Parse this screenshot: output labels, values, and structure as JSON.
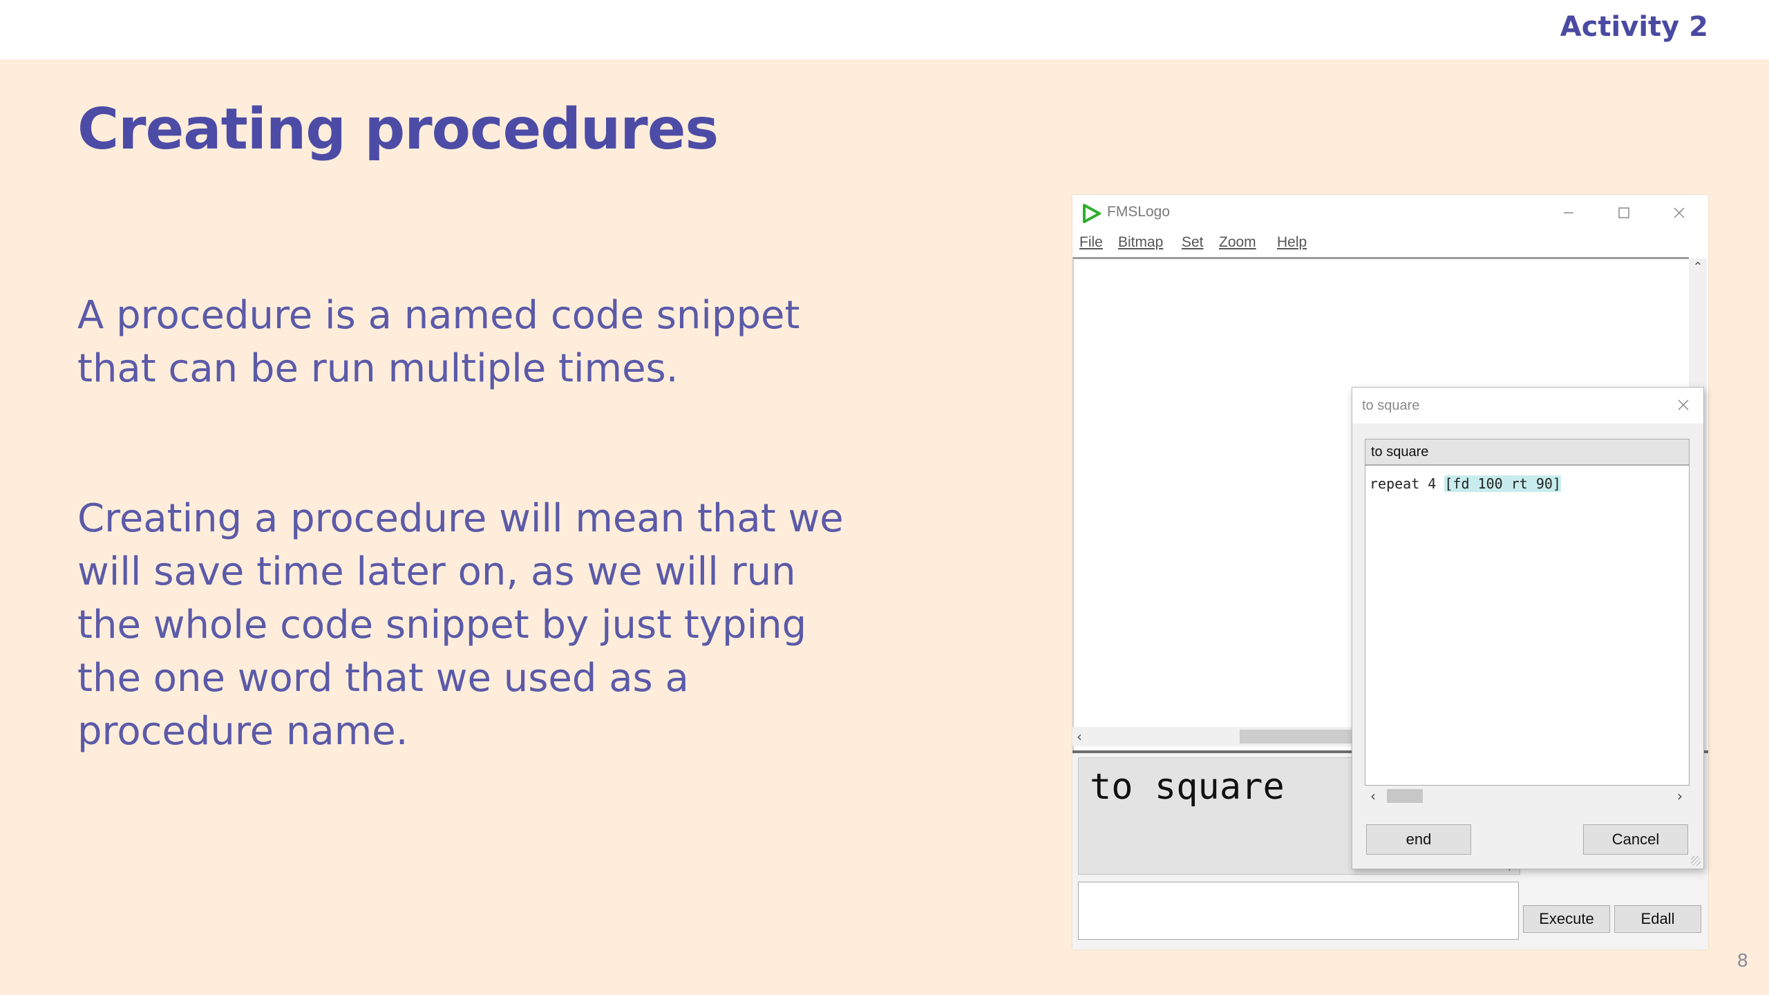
{
  "header": {
    "activity_label": "Activity 2"
  },
  "slide": {
    "title": "Creating procedures",
    "paragraph_1": "A procedure is a named code snippet that can be run multiple times.",
    "paragraph_2": "Creating a procedure will mean that we will save time later on, as we will run the whole code snippet by just typing the one word that we used as a procedure name.",
    "page_number": "8"
  },
  "fmslogo": {
    "window_title": "FMSLogo",
    "menu": [
      {
        "label": "File"
      },
      {
        "label": "Bitmap"
      },
      {
        "label": "Set"
      },
      {
        "label": "Zoom"
      },
      {
        "label": "Help"
      }
    ],
    "commander": {
      "history_text": "to square",
      "input_value": "",
      "execute_label": "Execute",
      "edall_label": "Edall"
    },
    "editor": {
      "title": "to square",
      "header_line": "to square",
      "code_prefix": "repeat 4 ",
      "code_highlight": "[fd 100 rt 90]",
      "end_label": "end",
      "cancel_label": "Cancel"
    }
  },
  "colors": {
    "slide_background": "#feeddb",
    "title_color": "#4c4ca6",
    "text_color": "#5b5aa8",
    "logo_green": "#2fae2f"
  },
  "icons": {
    "app": "fmslogo-play-icon",
    "minimize": "minimize-icon",
    "maximize": "maximize-icon",
    "close": "close-icon"
  }
}
